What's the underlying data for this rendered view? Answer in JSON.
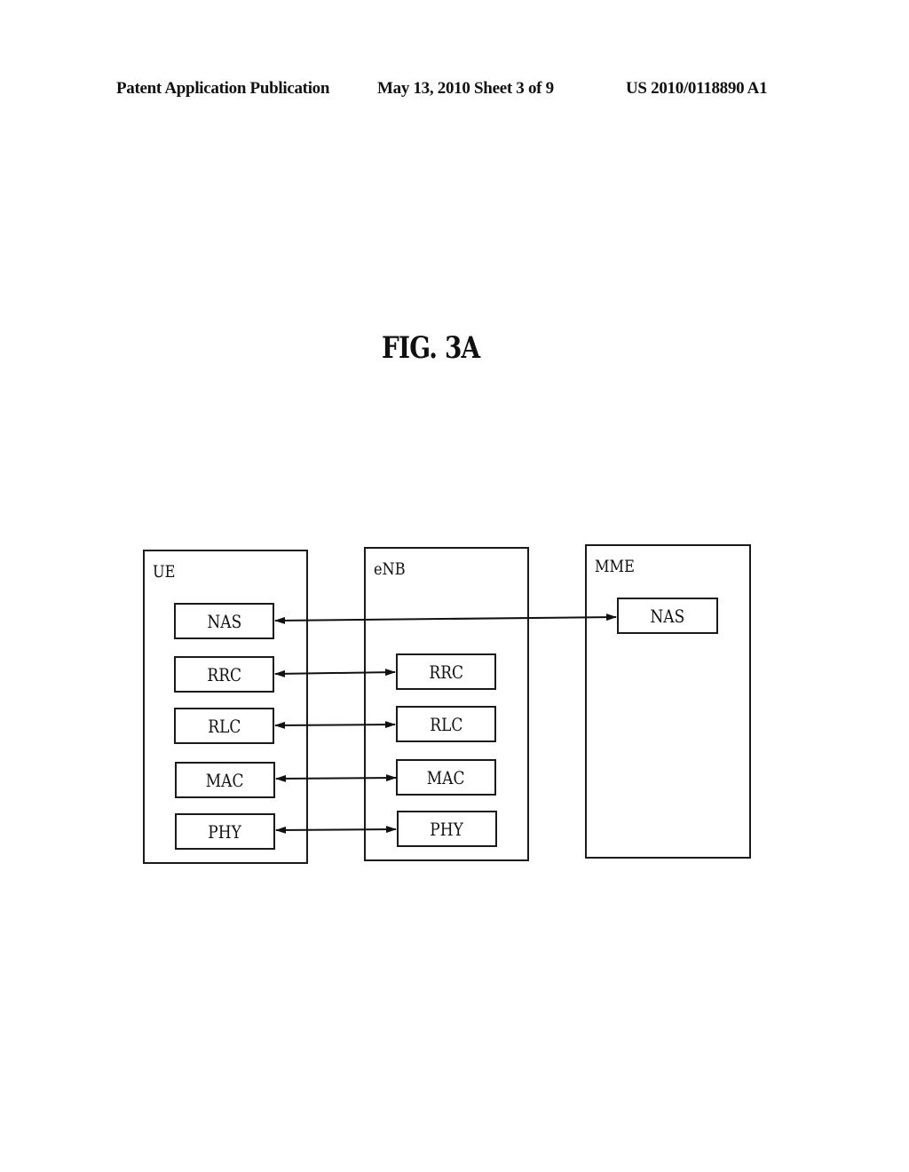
{
  "header": {
    "publication_type": "Patent Application Publication",
    "date_sheet": "May 13, 2010  Sheet 3 of 9",
    "patent_number": "US 2010/0118890 A1"
  },
  "figure": {
    "title": "FIG. 3A",
    "entities": [
      {
        "id": "ue",
        "label": "UE",
        "layers": [
          "NAS",
          "RRC",
          "RLC",
          "MAC",
          "PHY"
        ]
      },
      {
        "id": "enb",
        "label": "eNB",
        "layers": [
          "RRC",
          "RLC",
          "MAC",
          "PHY"
        ]
      },
      {
        "id": "mme",
        "label": "MME",
        "layers": [
          "NAS"
        ]
      }
    ],
    "connections": [
      {
        "from": "UE.NAS",
        "to": "MME.NAS",
        "type": "bidirectional"
      },
      {
        "from": "UE.RRC",
        "to": "eNB.RRC",
        "type": "bidirectional"
      },
      {
        "from": "UE.RLC",
        "to": "eNB.RLC",
        "type": "bidirectional"
      },
      {
        "from": "UE.MAC",
        "to": "eNB.MAC",
        "type": "bidirectional"
      },
      {
        "from": "UE.PHY",
        "to": "eNB.PHY",
        "type": "bidirectional"
      }
    ]
  }
}
